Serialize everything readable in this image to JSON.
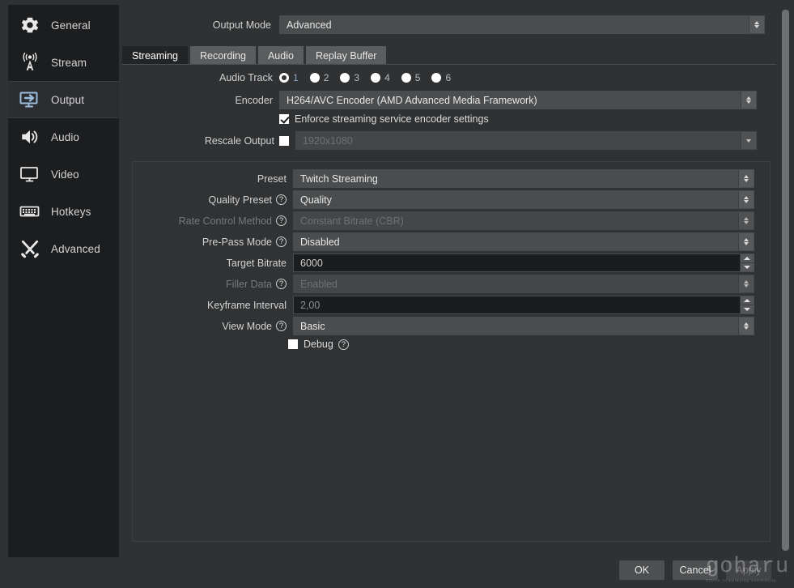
{
  "sidebar": {
    "items": [
      {
        "label": "General",
        "icon": "gear-icon",
        "active": false
      },
      {
        "label": "Stream",
        "icon": "antenna-icon",
        "active": false
      },
      {
        "label": "Output",
        "icon": "monitor-arrow-icon",
        "active": true
      },
      {
        "label": "Audio",
        "icon": "speaker-icon",
        "active": false
      },
      {
        "label": "Video",
        "icon": "monitor-icon",
        "active": false
      },
      {
        "label": "Hotkeys",
        "icon": "keyboard-icon",
        "active": false
      },
      {
        "label": "Advanced",
        "icon": "tools-icon",
        "active": false
      }
    ]
  },
  "output_mode": {
    "label": "Output Mode",
    "value": "Advanced"
  },
  "tabs": [
    {
      "label": "Streaming",
      "active": true
    },
    {
      "label": "Recording",
      "active": false
    },
    {
      "label": "Audio",
      "active": false
    },
    {
      "label": "Replay Buffer",
      "active": false
    }
  ],
  "streaming": {
    "audio_track": {
      "label": "Audio Track",
      "options": [
        "1",
        "2",
        "3",
        "4",
        "5",
        "6"
      ],
      "selected": "1"
    },
    "encoder": {
      "label": "Encoder",
      "value": "H264/AVC Encoder (AMD Advanced Media Framework)"
    },
    "enforce": {
      "label": "Enforce streaming service encoder settings",
      "checked": true
    },
    "rescale_output": {
      "label": "Rescale Output",
      "checked": false,
      "value": "1920x1080",
      "disabled": true
    }
  },
  "encoder_settings": {
    "preset": {
      "label": "Preset",
      "value": "Twitch Streaming",
      "help": false,
      "disabled": false,
      "type": "combo"
    },
    "quality_preset": {
      "label": "Quality Preset",
      "value": "Quality",
      "help": true,
      "disabled": false,
      "type": "combo"
    },
    "rate_control": {
      "label": "Rate Control Method",
      "value": "Constant Bitrate (CBR)",
      "help": true,
      "disabled": true,
      "type": "combo"
    },
    "pre_pass": {
      "label": "Pre-Pass Mode",
      "value": "Disabled",
      "help": true,
      "disabled": false,
      "type": "combo"
    },
    "target_bitrate": {
      "label": "Target Bitrate",
      "value": "6000",
      "help": false,
      "disabled": false,
      "type": "spin"
    },
    "filler_data": {
      "label": "Filler Data",
      "value": "Enabled",
      "help": true,
      "disabled": true,
      "type": "combo"
    },
    "keyframe": {
      "label": "Keyframe Interval",
      "value": "2,00",
      "help": false,
      "disabled": false,
      "type": "spin"
    },
    "view_mode": {
      "label": "View Mode",
      "value": "Basic",
      "help": true,
      "disabled": false,
      "type": "combo"
    },
    "debug": {
      "label": "Debug",
      "checked": false,
      "help": true
    }
  },
  "footer": {
    "ok": "OK",
    "cancel": "Cancel",
    "apply": "Apply",
    "apply_disabled": true
  },
  "watermark": {
    "text": "goharu",
    "subtext": "online roleplaying community"
  },
  "colors": {
    "window_bg": "#2f3133",
    "sidebar_bg": "#1c1d1f",
    "combo_bg": "#4a4c4e",
    "spin_bg": "#1b1c1e",
    "accent_icon": "#8fb0d4",
    "text": "#d4d4d4"
  },
  "help_glyph": "?"
}
